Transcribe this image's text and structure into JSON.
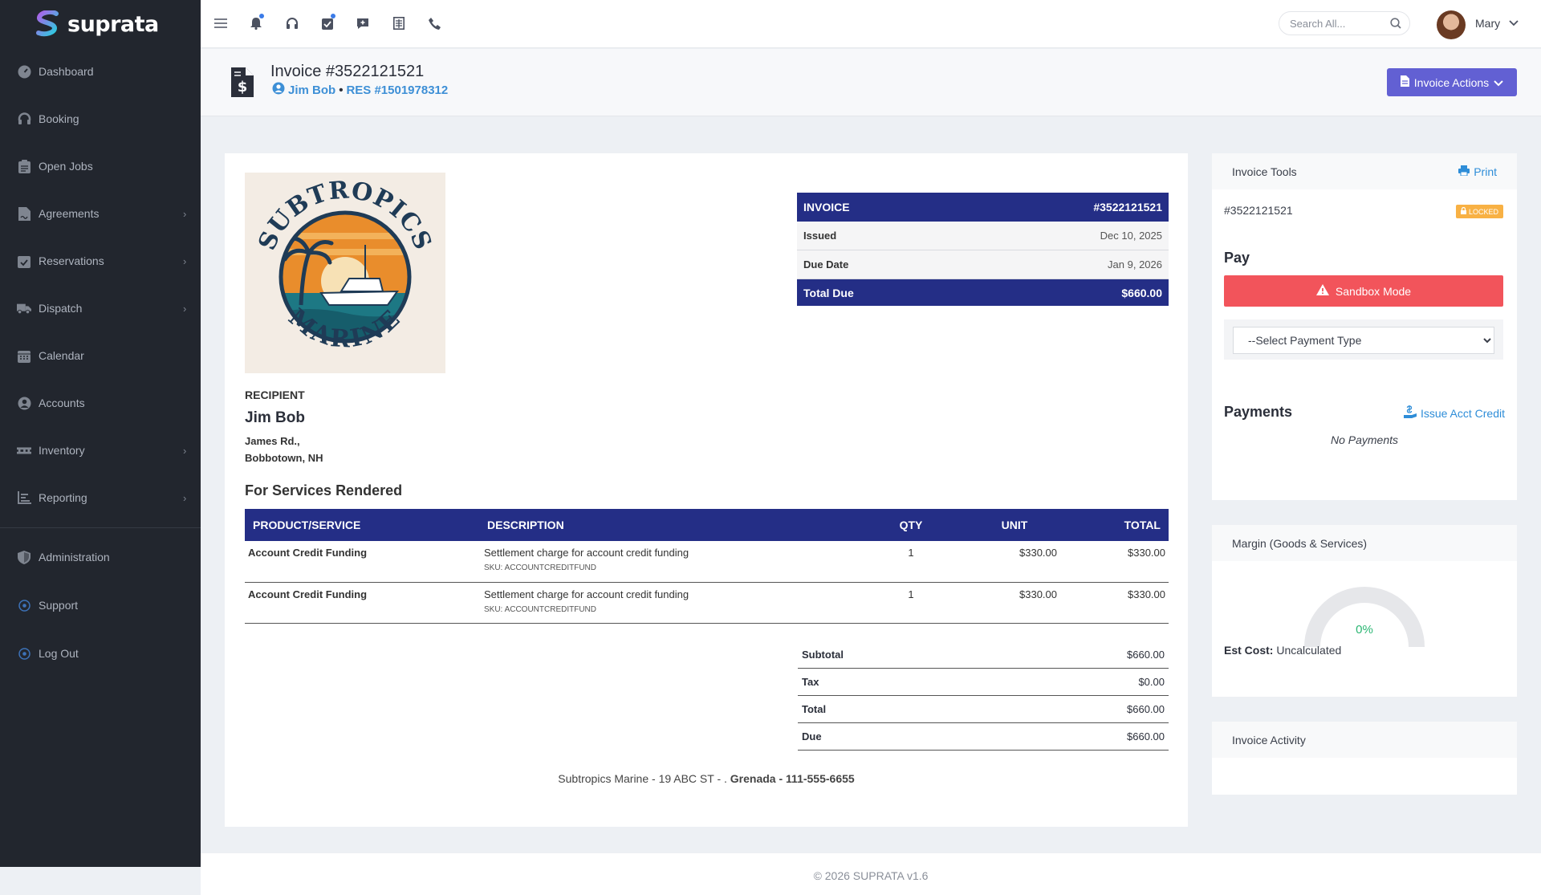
{
  "brand": {
    "name": "suprata"
  },
  "sidebar": {
    "items": [
      {
        "label": "Dashboard"
      },
      {
        "label": "Booking"
      },
      {
        "label": "Open Jobs"
      },
      {
        "label": "Agreements"
      },
      {
        "label": "Reservations"
      },
      {
        "label": "Dispatch"
      },
      {
        "label": "Calendar"
      },
      {
        "label": "Accounts"
      },
      {
        "label": "Inventory"
      },
      {
        "label": "Reporting"
      },
      {
        "label": "Administration"
      },
      {
        "label": "Support"
      },
      {
        "label": "Log Out"
      }
    ]
  },
  "topbar": {
    "search_placeholder": "Search All...",
    "user_name": "Mary",
    "icons": [
      "menu-icon",
      "bell-icon",
      "headset-icon",
      "clipboard-check-icon",
      "comment-plus-icon",
      "ledger-icon",
      "phone-icon"
    ]
  },
  "header": {
    "title": "Invoice #3522121521",
    "customer": "Jim Bob",
    "separator": "•",
    "reservation": "RES #1501978312",
    "actions_label": "Invoice Actions"
  },
  "invoice": {
    "summary": {
      "label": "INVOICE",
      "number": "#3522121521",
      "issued_label": "Issued",
      "issued": "Dec 10, 2025",
      "due_label": "Due Date",
      "due": "Jan 9, 2026",
      "total_label": "Total Due",
      "total": "$660.00"
    },
    "recipient": {
      "label": "RECIPIENT",
      "name": "Jim Bob",
      "address1": "James Rd.,",
      "address2": "Bobbotown, NH"
    },
    "services_title": "For Services Rendered",
    "columns": [
      "PRODUCT/SERVICE",
      "DESCRIPTION",
      "QTY",
      "UNIT",
      "TOTAL"
    ],
    "items": [
      {
        "name": "Account Credit Funding",
        "description": "Settlement charge for account credit funding",
        "sku": "SKU: ACCOUNTCREDITFUND",
        "qty": "1",
        "unit": "$330.00",
        "total": "$330.00"
      },
      {
        "name": "Account Credit Funding",
        "description": "Settlement charge for account credit funding",
        "sku": "SKU: ACCOUNTCREDITFUND",
        "qty": "1",
        "unit": "$330.00",
        "total": "$330.00"
      }
    ],
    "totals": [
      {
        "label": "Subtotal",
        "value": "$660.00"
      },
      {
        "label": "Tax",
        "value": "$0.00"
      },
      {
        "label": "Total",
        "value": "$660.00"
      },
      {
        "label": "Due",
        "value": "$660.00"
      }
    ],
    "company_footer": {
      "name_address": "Subtropics Marine - 19 ABC ST - .",
      "country_phone": "Grenada - 111-555-6655"
    },
    "logo_text": {
      "top": "SUBTROPICS",
      "bottom": "MARINE"
    }
  },
  "tools": {
    "title": "Invoice Tools",
    "print_label": "Print",
    "invoice_number": "#3522121521",
    "locked_label": "LOCKED",
    "pay_title": "Pay",
    "sandbox_label": "Sandbox Mode",
    "payment_select": "--Select Payment Type",
    "payments_title": "Payments",
    "issue_credit_label": "Issue Acct Credit",
    "no_payments": "No Payments"
  },
  "margin": {
    "title": "Margin (Goods & Services)",
    "value": "0%",
    "percent": 0,
    "est_cost_label": "Est Cost:",
    "est_cost_value": "Uncalculated"
  },
  "activity": {
    "title": "Invoice Activity"
  },
  "footer": {
    "copyright": "© 2026 SUPRATA v1.6"
  },
  "colors": {
    "sidebar": "#22262e",
    "accent": "#6260d3",
    "invoice_header": "#242e86",
    "danger": "#f2545b",
    "link": "#2e8dd8",
    "locked": "#f8b144",
    "gauge_value": "#2bb673"
  }
}
